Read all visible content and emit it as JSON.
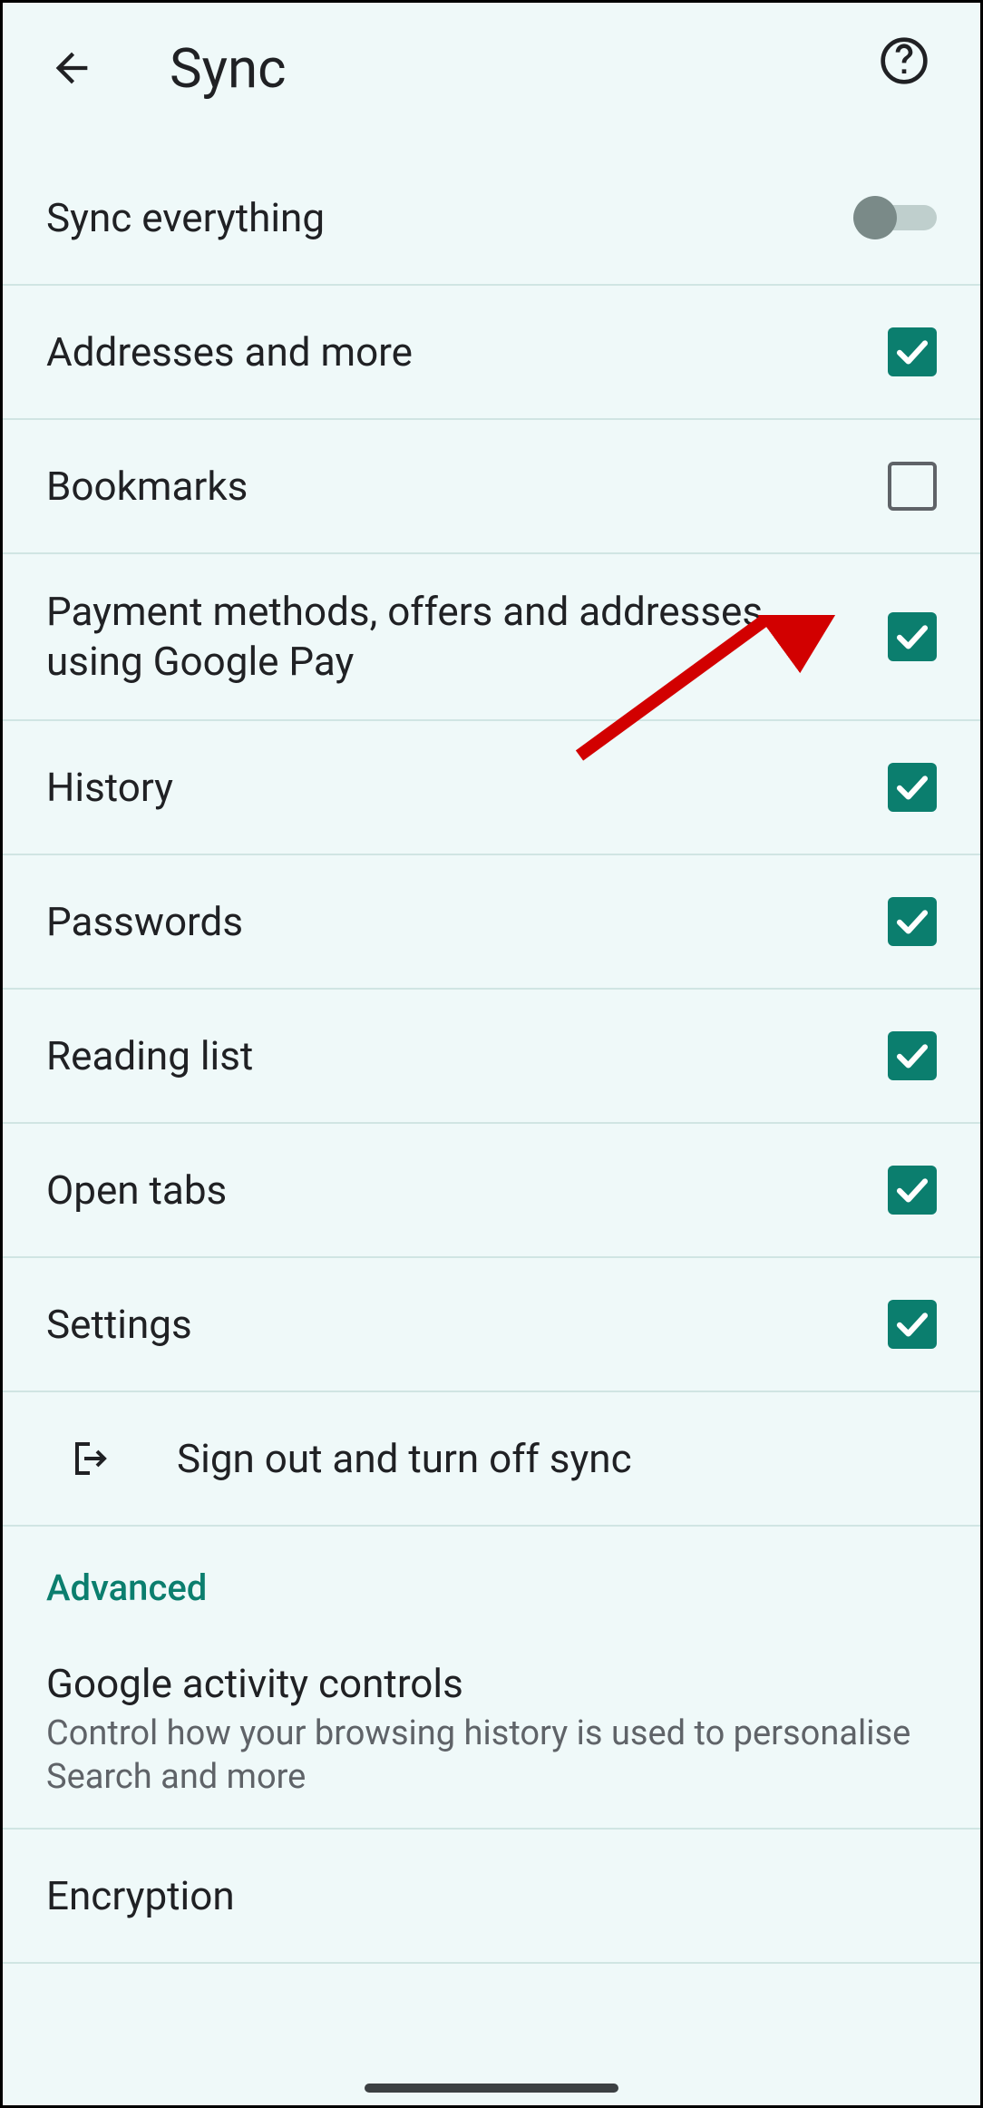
{
  "header": {
    "title": "Sync"
  },
  "sync_everything": {
    "label": "Sync everything",
    "on": false
  },
  "items": [
    {
      "label": "Addresses and more",
      "checked": true
    },
    {
      "label": "Bookmarks",
      "checked": false
    },
    {
      "label": "Payment methods, offers and addresses using Google Pay",
      "checked": true
    },
    {
      "label": "History",
      "checked": true
    },
    {
      "label": "Passwords",
      "checked": true
    },
    {
      "label": "Reading list",
      "checked": true
    },
    {
      "label": "Open tabs",
      "checked": true
    },
    {
      "label": "Settings",
      "checked": true
    }
  ],
  "signout": {
    "label": "Sign out and turn off sync"
  },
  "advanced": {
    "header": "Advanced",
    "activity": {
      "title": "Google activity controls",
      "subtitle": "Control how your browsing history is used to personalise Search and more"
    },
    "encryption": {
      "title": "Encryption"
    }
  }
}
